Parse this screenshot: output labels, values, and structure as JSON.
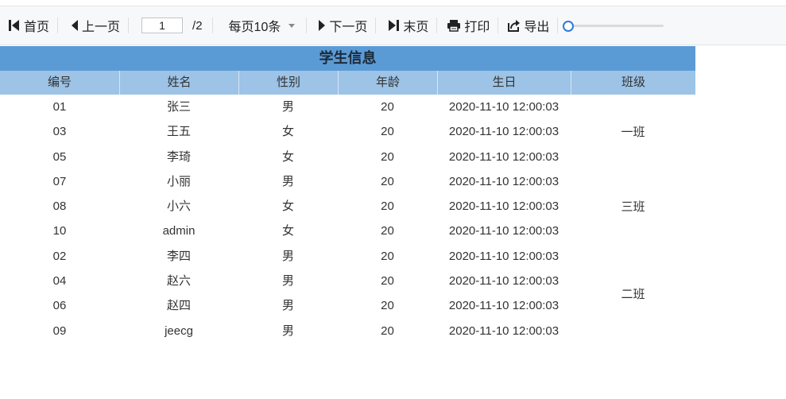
{
  "toolbar": {
    "first_label": "首页",
    "prev_label": "上一页",
    "page_value": "1",
    "page_total": "/2",
    "page_size_label": "每页10条",
    "next_label": "下一页",
    "last_label": "末页",
    "print_label": "打印",
    "export_label": "导出",
    "zoom_fraction": 0.0
  },
  "report": {
    "title": "学生信息",
    "columns": [
      "编号",
      "姓名",
      "性别",
      "年龄",
      "生日",
      "班级"
    ],
    "rows": [
      {
        "id": "01",
        "name": "张三",
        "sex": "男",
        "age": "20",
        "birthday": "2020-11-10 12:00:03"
      },
      {
        "id": "03",
        "name": "王五",
        "sex": "女",
        "age": "20",
        "birthday": "2020-11-10 12:00:03"
      },
      {
        "id": "05",
        "name": "李琦",
        "sex": "女",
        "age": "20",
        "birthday": "2020-11-10 12:00:03"
      },
      {
        "id": "07",
        "name": "小丽",
        "sex": "男",
        "age": "20",
        "birthday": "2020-11-10 12:00:03"
      },
      {
        "id": "08",
        "name": "小六",
        "sex": "女",
        "age": "20",
        "birthday": "2020-11-10 12:00:03"
      },
      {
        "id": "10",
        "name": "admin",
        "sex": "女",
        "age": "20",
        "birthday": "2020-11-10 12:00:03"
      },
      {
        "id": "02",
        "name": "李四",
        "sex": "男",
        "age": "20",
        "birthday": "2020-11-10 12:00:03"
      },
      {
        "id": "04",
        "name": "赵六",
        "sex": "男",
        "age": "20",
        "birthday": "2020-11-10 12:00:03"
      },
      {
        "id": "06",
        "name": "赵四",
        "sex": "男",
        "age": "20",
        "birthday": "2020-11-10 12:00:03"
      },
      {
        "id": "09",
        "name": "jeecg",
        "sex": "男",
        "age": "20",
        "birthday": "2020-11-10 12:00:03"
      }
    ],
    "class_groups": [
      {
        "label": "一班",
        "span": 3
      },
      {
        "label": "三班",
        "span": 3
      },
      {
        "label": "二班",
        "span": 4
      }
    ]
  },
  "colors": {
    "title_bg": "#5b9bd5",
    "header_bg": "#9dc3e6",
    "accent": "#2f7bd6"
  }
}
